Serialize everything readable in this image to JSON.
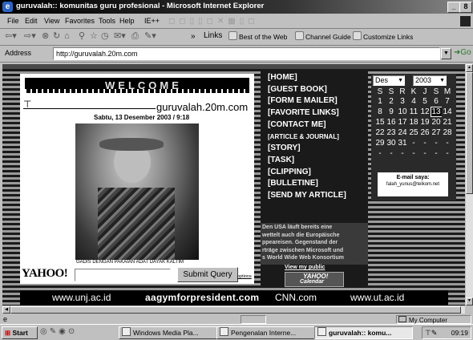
{
  "window": {
    "title": "guruvalah:: komunitas guru profesional - Microsoft Internet Explorer",
    "controls": [
      "_",
      "8"
    ]
  },
  "menubar": [
    "File",
    "Edit",
    "View",
    "Favorites",
    "Tools",
    "Help",
    "IE++"
  ],
  "links_bar": {
    "label": "Links",
    "items": [
      "Best of the Web",
      "Channel Guide",
      "Customize Links"
    ]
  },
  "address": {
    "label": "Address",
    "url": "http://guruvalah.20m.com",
    "go_label": "Go"
  },
  "site": {
    "welcome": "WELCOME",
    "domain": "guruvalah.20m.com",
    "date": "Sabtu, 13 Desember 2003 / 9:18",
    "photo_caption": "GADIS DENGAN PAKAIAN ADAT DAYAK KALTIM",
    "yahoo_logo": "YAHOO!",
    "search_value": "",
    "submit_label": "Submit Query",
    "options_label": "options",
    "menu": [
      "[HOME]",
      "[GUEST BOOK]",
      "[FORM E MAILER]",
      "[FAVORITE LINKS]",
      "[CONTACT ME]",
      "[ARTICLE & JOURNAL]",
      "[STORY]",
      "[TASK]",
      "[CLIPPING]",
      "[BULLETINE]",
      "[SEND MY ARTICLE]"
    ],
    "ticker_lines": [
      "Den USA läuft bereits eine",
      "wettelt auch die Europäische",
      "ppeareisen. Gegenstand der",
      "rträge zwischen Microsoft und",
      "s World Wide Web Konsortium"
    ],
    "view_public": "View my public",
    "yahoo_calendar_1": "YAHOO!",
    "yahoo_calendar_2": "Calendar",
    "calendar": {
      "month": "Des",
      "year": "2003",
      "weekdays": [
        "S",
        "S",
        "R",
        "K",
        "J",
        "S",
        "M"
      ],
      "rows": [
        [
          "1",
          "2",
          "3",
          "4",
          "5",
          "6",
          "7"
        ],
        [
          "8",
          "9",
          "10",
          "11",
          "12",
          "13",
          "14"
        ],
        [
          "15",
          "16",
          "17",
          "18",
          "19",
          "20",
          "21"
        ],
        [
          "22",
          "23",
          "24",
          "25",
          "26",
          "27",
          "28"
        ],
        [
          "29",
          "30",
          "31",
          "-",
          "-",
          "-",
          "-"
        ],
        [
          "-",
          "-",
          "-",
          "-",
          "-",
          "-",
          "-"
        ]
      ],
      "selected": "13"
    },
    "email_label": "E-mail saya:",
    "email": "falah_yunus@telkom.net",
    "bottom_links": [
      "www.unj.ac.id",
      "aagymforpresident.com",
      "CNN.com",
      "www.ut.ac.id"
    ]
  },
  "statusbar": {
    "zone": "My Computer"
  },
  "taskbar": {
    "start": "Start",
    "tasks": [
      "Windows Media Pla...",
      "Pengenalan Interne...",
      "guruvalah:: komu..."
    ],
    "clock": "09:19"
  },
  "colors": {
    "titlebar": "#000000",
    "face": "#c0c0c0",
    "page_dark": "#1a1a1a",
    "calendar_bg": "#2a2a2a"
  }
}
